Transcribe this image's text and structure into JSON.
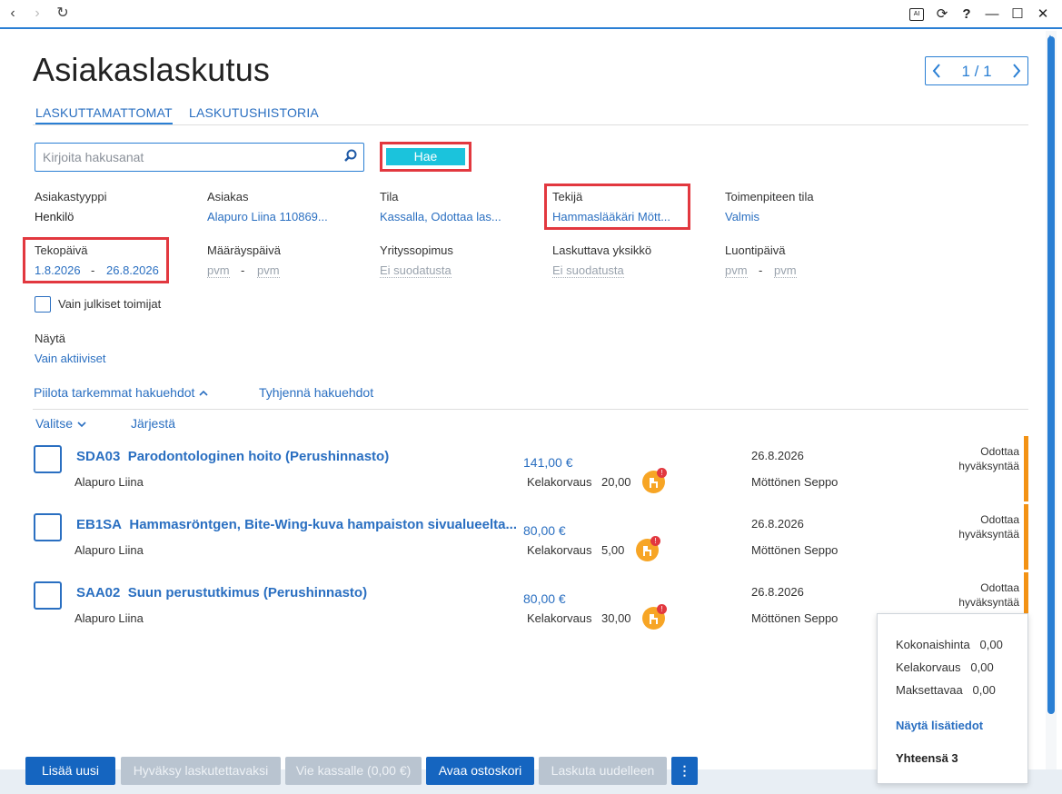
{
  "window": {
    "back": "‹",
    "forward": "›",
    "refresh": "↻",
    "ai": "AI",
    "history": "⟳",
    "help": "?",
    "minimize": "—",
    "maximize": "☐",
    "close": "✕"
  },
  "page": {
    "title": "Asiakaslaskutus"
  },
  "pager": {
    "text": "1 / 1"
  },
  "tabs": [
    {
      "label": "LASKUTTAMATTOMAT",
      "active": true
    },
    {
      "label": "LASKUTUSHISTORIA",
      "active": false
    }
  ],
  "search": {
    "placeholder": "Kirjoita hakusanat",
    "value": "",
    "button": "Hae"
  },
  "filters": {
    "asiakastyyppi": {
      "label": "Asiakastyyppi",
      "value": "Henkilö"
    },
    "asiakas": {
      "label": "Asiakas",
      "value": "Alapuro Liina 110869..."
    },
    "tila": {
      "label": "Tila",
      "value": "Kassalla, Odottaa las..."
    },
    "tekija": {
      "label": "Tekijä",
      "value": "Hammaslääkäri Mött..."
    },
    "toimenpiteen_tila": {
      "label": "Toimenpiteen tila",
      "value": "Valmis"
    },
    "tekopaiva": {
      "label": "Tekopäivä",
      "from": "1.8.2026",
      "to": "26.8.2026"
    },
    "maarayspaiva": {
      "label": "Määräyspäivä",
      "from": "pvm",
      "to": "pvm"
    },
    "yrityssopimus": {
      "label": "Yrityssopimus",
      "value": "Ei suodatusta"
    },
    "laskuttava_yksikko": {
      "label": "Laskuttava yksikkö",
      "value": "Ei suodatusta"
    },
    "luontipaiva": {
      "label": "Luontipäivä",
      "from": "pvm",
      "to": "pvm"
    },
    "range_sep": "-"
  },
  "public_only": {
    "label": "Vain julkiset toimijat",
    "checked": false
  },
  "show": {
    "label": "Näytä",
    "value": "Vain aktiiviset"
  },
  "actions": {
    "hide": "Piilota tarkemmat hakuehdot",
    "clear": "Tyhjennä hakuehdot"
  },
  "list_tools": {
    "select": "Valitse",
    "sort": "Järjestä"
  },
  "rows": [
    {
      "code": "SDA03",
      "name": "Parodontologinen hoito (Perushinnasto)",
      "customer": "Alapuro Liina",
      "price": "141,00 €",
      "kela_label": "Kelakorvaus",
      "kela": "20,00",
      "date": "26.8.2026",
      "doctor": "Möttönen Seppo",
      "status1": "Odottaa",
      "status2": "hyväksyntää"
    },
    {
      "code": "EB1SA",
      "name": "Hammasröntgen, Bite-Wing-kuva hampaiston sivualueelta...",
      "customer": "Alapuro Liina",
      "price": "80,00 €",
      "kela_label": "Kelakorvaus",
      "kela": "5,00",
      "date": "26.8.2026",
      "doctor": "Möttönen Seppo",
      "status1": "Odottaa",
      "status2": "hyväksyntää"
    },
    {
      "code": "SAA02",
      "name": "Suun perustutkimus (Perushinnasto)",
      "customer": "Alapuro Liina",
      "price": "80,00 €",
      "kela_label": "Kelakorvaus",
      "kela": "30,00",
      "date": "26.8.2026",
      "doctor": "Möttönen Seppo",
      "status1": "Odottaa",
      "status2": "hyväksyntää"
    }
  ],
  "summary": {
    "total_label": "Kokonaishinta",
    "total": "0,00",
    "kela_label": "Kelakorvaus",
    "kela": "0,00",
    "pay_label": "Maksettavaa",
    "pay": "0,00",
    "more": "Näytä lisätiedot",
    "count": "Yhteensä 3"
  },
  "buttons": {
    "add": "Lisää uusi",
    "approve": "Hyväksy laskutettavaksi",
    "to_cashier": "Vie kassalle (0,00 €)",
    "open_cart": "Avaa ostoskori",
    "reinvoice": "Laskuta uudelleen",
    "more": "⋮"
  },
  "colors": {
    "accent": "#2a7fd4",
    "link": "#2a6fc1",
    "hae": "#1bc3dc",
    "highlight": "#e2383f",
    "pending": "#f39214",
    "primary_button": "#1565c0"
  }
}
